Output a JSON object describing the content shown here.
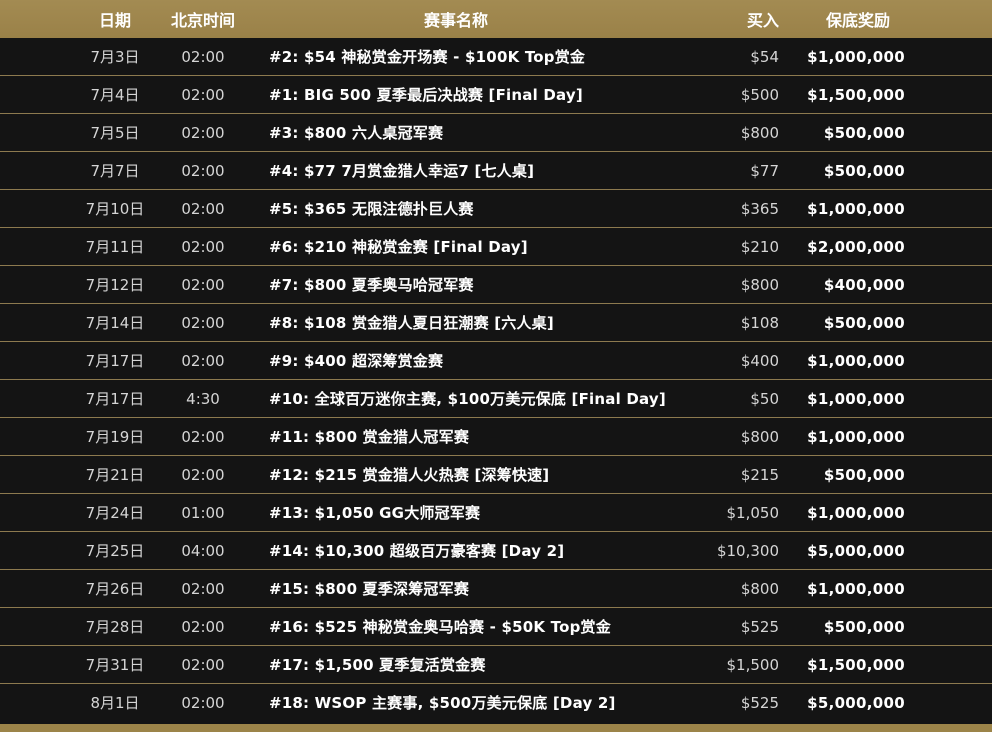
{
  "colors": {
    "header_gold": "#a38b52",
    "row_background": "#141414",
    "divider_gold": "#8d7a4f",
    "text_white": "#ffffff",
    "text_gray": "#d5d5d5"
  },
  "header": {
    "date": "日期",
    "time": "北京时间",
    "name": "赛事名称",
    "buyin": "买入",
    "prize": "保底奖励"
  },
  "rows": [
    {
      "date": "7月3日",
      "time": "02:00",
      "name": "#2: $54 神秘赏金开场赛 - $100K Top赏金",
      "buyin": "$54",
      "prize": "$1,000,000"
    },
    {
      "date": "7月4日",
      "time": "02:00",
      "name": "#1: BIG 500 夏季最后决战赛 [Final Day]",
      "buyin": "$500",
      "prize": "$1,500,000"
    },
    {
      "date": "7月5日",
      "time": "02:00",
      "name": "#3: $800 六人桌冠军赛",
      "buyin": "$800",
      "prize": "$500,000"
    },
    {
      "date": "7月7日",
      "time": "02:00",
      "name": "#4: $77 7月赏金猎人幸运7 [七人桌]",
      "buyin": "$77",
      "prize": "$500,000"
    },
    {
      "date": "7月10日",
      "time": "02:00",
      "name": "#5: $365 无限注德扑巨人赛",
      "buyin": "$365",
      "prize": "$1,000,000"
    },
    {
      "date": "7月11日",
      "time": "02:00",
      "name": "#6: $210 神秘赏金赛 [Final Day]",
      "buyin": "$210",
      "prize": "$2,000,000"
    },
    {
      "date": "7月12日",
      "time": "02:00",
      "name": "#7: $800 夏季奥马哈冠军赛",
      "buyin": "$800",
      "prize": "$400,000"
    },
    {
      "date": "7月14日",
      "time": "02:00",
      "name": "#8: $108 赏金猎人夏日狂潮赛 [六人桌]",
      "buyin": "$108",
      "prize": "$500,000"
    },
    {
      "date": "7月17日",
      "time": "02:00",
      "name": "#9: $400 超深筹赏金赛",
      "buyin": "$400",
      "prize": "$1,000,000"
    },
    {
      "date": "7月17日",
      "time": "4:30",
      "name": "#10: 全球百万迷你主赛, $100万美元保底 [Final Day]",
      "buyin": "$50",
      "prize": "$1,000,000"
    },
    {
      "date": "7月19日",
      "time": "02:00",
      "name": "#11: $800 赏金猎人冠军赛",
      "buyin": "$800",
      "prize": "$1,000,000"
    },
    {
      "date": "7月21日",
      "time": "02:00",
      "name": "#12: $215 赏金猎人火热赛 [深筹快速]",
      "buyin": "$215",
      "prize": "$500,000"
    },
    {
      "date": "7月24日",
      "time": "01:00",
      "name": "#13: $1,050 GG大师冠军赛",
      "buyin": "$1,050",
      "prize": "$1,000,000"
    },
    {
      "date": "7月25日",
      "time": "04:00",
      "name": "#14: $10,300 超级百万豪客赛 [Day 2]",
      "buyin": "$10,300",
      "prize": "$5,000,000"
    },
    {
      "date": "7月26日",
      "time": "02:00",
      "name": "#15: $800 夏季深筹冠军赛",
      "buyin": "$800",
      "prize": "$1,000,000"
    },
    {
      "date": "7月28日",
      "time": "02:00",
      "name": "#16: $525 神秘赏金奥马哈赛 - $50K Top赏金",
      "buyin": "$525",
      "prize": "$500,000"
    },
    {
      "date": "7月31日",
      "time": "02:00",
      "name": "#17: $1,500 夏季复活赏金赛",
      "buyin": "$1,500",
      "prize": "$1,500,000"
    },
    {
      "date": "8月1日",
      "time": "02:00",
      "name": "#18: WSOP 主赛事, $500万美元保底 [Day 2]",
      "buyin": "$525",
      "prize": "$5,000,000"
    }
  ]
}
